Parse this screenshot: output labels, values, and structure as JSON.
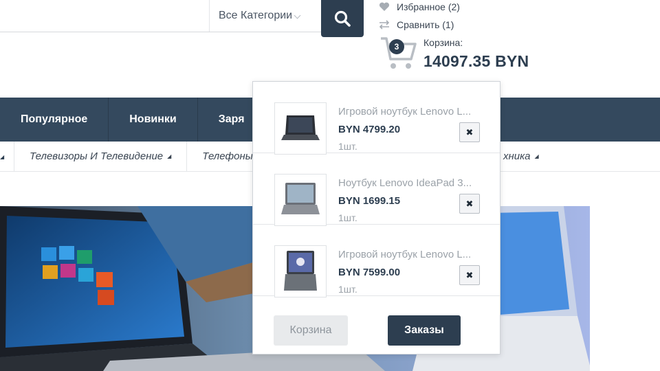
{
  "search": {
    "placeholder": "",
    "category_label": "Все Категории"
  },
  "header": {
    "wishlist": "Избранное (2)",
    "compare": "Сравнить (1)",
    "cart": {
      "count": "3",
      "label": "Корзина:",
      "total": "14097.35 BYN"
    }
  },
  "nav": {
    "items": [
      {
        "label": "Популярное"
      },
      {
        "label": "Новинки"
      },
      {
        "label": "Заря"
      }
    ]
  },
  "subnav": {
    "items": [
      {
        "label": "Телевизоры И Телевидение"
      },
      {
        "label": "Телефоны"
      },
      {
        "label": "хника"
      }
    ]
  },
  "cart_dropdown": {
    "items": [
      {
        "name": "Игровой ноутбук Lenovo L...",
        "price": "BYN 4799.20",
        "qty": "1шт.",
        "remove": "✖"
      },
      {
        "name": "Ноутбук Lenovo IdeaPad 3...",
        "price": "BYN 1699.15",
        "qty": "1шт.",
        "remove": "✖"
      },
      {
        "name": "Игровой ноутбук Lenovo L...",
        "price": "BYN 7599.00",
        "qty": "1шт.",
        "remove": "✖"
      }
    ],
    "cart_button": "Корзина",
    "orders_button": "Заказы"
  },
  "colors": {
    "primary": "#2d3e50",
    "nav_bg": "#34495e",
    "muted_text": "#9aa1a8"
  },
  "icons": {
    "search": "search-icon",
    "wishlist": "heart-icon",
    "compare": "compare-arrows-icon",
    "cart": "cart-icon",
    "remove": "close-icon"
  }
}
